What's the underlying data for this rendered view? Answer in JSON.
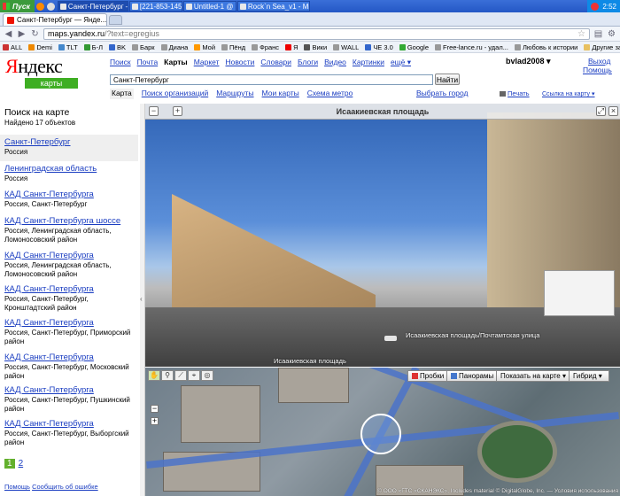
{
  "taskbar": {
    "start": "Пуск",
    "tasks": [
      "Санкт-Петербург — Янде...",
      "[221-853-145] - Окно со...",
      "Untitled-1 @ 66,7% (Lay...",
      "Rock`n Sea_v1 - Microso..."
    ],
    "clock": "2:52"
  },
  "browser": {
    "tabs": [
      {
        "label": "Санкт-Петербург — Янде...",
        "close": "×"
      }
    ],
    "back": "◀",
    "forward": "▶",
    "reload": "↻",
    "url_host": "maps.yandex.ru",
    "url_path": "/?text=egregius",
    "bookmarks": [
      "ALL",
      "Demi",
      "TLT",
      "Б-Л",
      "BK",
      "Барк",
      "Диана",
      "Мой",
      "Пёнд",
      "Франс",
      "Я",
      "Вики",
      "WALL",
      "ЧЕ 3.0",
      "Google",
      "Free-lance.ru - удал...",
      "Любовь к истории"
    ],
    "other_bookmarks": "Другие закладки"
  },
  "header": {
    "logo": "Яндекс",
    "logo_sub": "карты",
    "nav": [
      "Поиск",
      "Почта",
      "Карты",
      "Маркет",
      "Новости",
      "Словари",
      "Блоги",
      "Видео",
      "Картинки",
      "ещё ▾"
    ],
    "user": "bvlad2008 ▾",
    "exit": "Выход",
    "help": "Помощь",
    "search_value": "Санкт-Петербург",
    "search_button": "Найти",
    "subnav": [
      "Карта",
      "Поиск организаций",
      "Маршруты",
      "Мои карты",
      "Схема метро"
    ],
    "region": "Выбрать город",
    "print": "Печать",
    "map_link": "Ссылка на карту ▾"
  },
  "sidebar": {
    "title": "Поиск на карте",
    "count": "Найдено 17 объектов",
    "results": [
      {
        "name": "Санкт-Петербург",
        "desc": "Россия"
      },
      {
        "name": "Ленинградская область",
        "desc": "Россия"
      },
      {
        "name": "КАД Санкт-Петербурга",
        "desc": "Россия, Санкт-Петербург"
      },
      {
        "name": "КАД Санкт-Петербурга шоссе",
        "desc": "Россия, Ленинградская область, Ломоносовский район"
      },
      {
        "name": "КАД Санкт-Петербурга",
        "desc": "Россия, Ленинградская область, Ломоносовский район"
      },
      {
        "name": "КАД Санкт-Петербурга",
        "desc": "Россия, Санкт-Петербург, Кронштадтский район"
      },
      {
        "name": "КАД Санкт-Петербурга",
        "desc": "Россия, Санкт-Петербург, Приморский район"
      },
      {
        "name": "КАД Санкт-Петербурга",
        "desc": "Россия, Санкт-Петербург, Московский район"
      },
      {
        "name": "КАД Санкт-Петербурга",
        "desc": "Россия, Санкт-Петербург, Пушкинский район"
      },
      {
        "name": "КАД Санкт-Петербурга",
        "desc": "Россия, Санкт-Петербург, Выборгский район"
      }
    ],
    "pages": [
      "1",
      "2"
    ],
    "help": "Помощь",
    "report": "Сообщить об ошибке"
  },
  "panorama": {
    "title": "Исаакиевская площадь",
    "caption": "Исаакиевская площадь/Почтамтская улица",
    "caption2": "Исаакиевская площадь",
    "minus": "−",
    "plus": "+"
  },
  "map": {
    "traffic": "Пробки",
    "panoramas": "Панорамы",
    "show_on_map": "Показать на карте ▾",
    "layer": "Гибрид ▾",
    "zoom_minus": "−",
    "zoom_plus": "+",
    "copyright": "© ООО «ГТС «СКАНЭКС», Includes material © DigitalGlobe, Inc. — Условия использования"
  },
  "colors": {
    "brand_red": "#ff0000",
    "link": "#1a3dc1",
    "green": "#3eae23"
  }
}
